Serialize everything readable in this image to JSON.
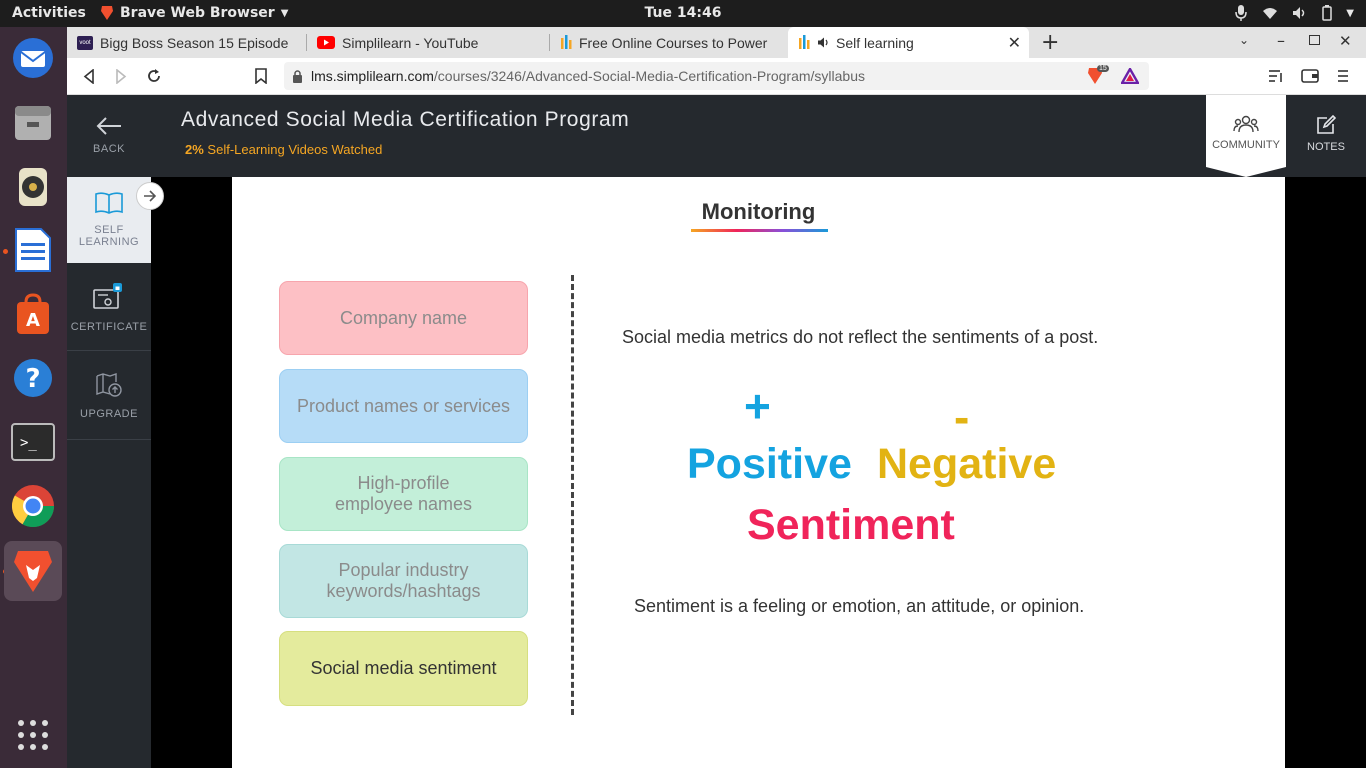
{
  "topbar": {
    "activities": "Activities",
    "app_name": "Brave Web Browser",
    "clock": "Tue 14:46"
  },
  "tabs": [
    {
      "label": "Bigg Boss Season 15 Episode",
      "icon": "voot-icon"
    },
    {
      "label": "Simplilearn - YouTube",
      "icon": "youtube-icon"
    },
    {
      "label": "Free Online Courses to Power",
      "icon": "simplilearn-icon"
    },
    {
      "label": "Self learning",
      "icon": "simplilearn-icon",
      "active": true
    }
  ],
  "address": {
    "host": "lms.simplilearn.com",
    "path": "/courses/3246/Advanced-Social-Media-Certification-Program/syllabus",
    "shields_count": "15"
  },
  "lms": {
    "title": "Advanced Social Media Certification Program",
    "progress_pct": "2%",
    "progress_text": "Self-Learning Videos Watched",
    "community": "COMMUNITY",
    "notes": "NOTES",
    "side": {
      "back": "BACK",
      "self1": "SELF",
      "self2": "LEARNING",
      "certificate": "CERTIFICATE",
      "upgrade": "UPGRADE"
    }
  },
  "slide": {
    "heading": "Monitoring",
    "items": [
      {
        "line1": "Company name",
        "line2": ""
      },
      {
        "line1": "Product names or services",
        "line2": ""
      },
      {
        "line1": "High-profile",
        "line2": "employee names"
      },
      {
        "line1": "Popular industry",
        "line2": "keywords/hashtags"
      },
      {
        "line1": "Social media sentiment",
        "line2": ""
      }
    ],
    "metrics_text": "Social media metrics do not reflect the sentiments of a post.",
    "plus": "+",
    "minus": "-",
    "positive": "Positive",
    "negative": "Negative",
    "sentiment": "Sentiment",
    "definition": "Sentiment is a feeling or emotion, an attitude, or opinion."
  },
  "colors": {
    "accent_orange": "#f5a623",
    "positive": "#14a3e0",
    "negative": "#e2b313",
    "sentiment": "#f0245a"
  }
}
